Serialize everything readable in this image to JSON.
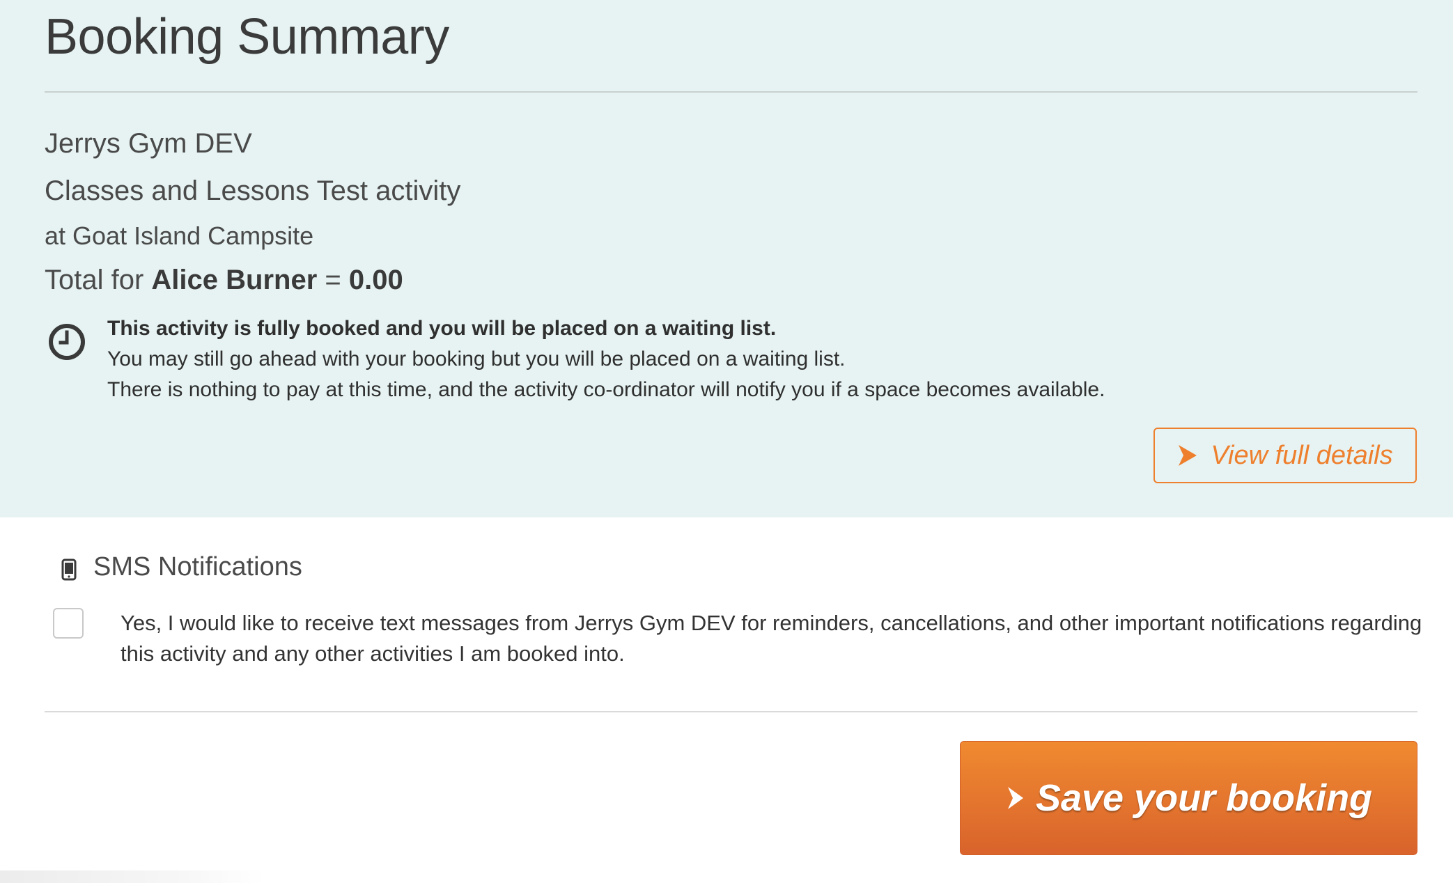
{
  "summary": {
    "title": "Booking Summary",
    "venue": "Jerrys Gym DEV",
    "activity": "Classes and Lessons Test activity",
    "location": "at Goat Island Campsite",
    "total_prefix": "Total for",
    "participant": "Alice Burner",
    "equals": "=",
    "amount": "0.00"
  },
  "waitlist": {
    "icon": "clock-icon",
    "heading": "This activity is fully booked and you will be placed on a waiting list.",
    "line1": "You may still go ahead with your booking but you will be placed on a waiting list.",
    "line2": "There is nothing to pay at this time, and the activity co-ordinator will notify you if a space becomes available."
  },
  "details_button": {
    "label": "View full details",
    "icon": "chevron-right-icon"
  },
  "sms": {
    "icon": "mobile-phone-icon",
    "heading": "SMS Notifications",
    "consent_text": "Yes, I would like to receive text messages from Jerrys Gym DEV for reminders, cancellations, and other important notifications regarding this activity and any other activities I am booked into.",
    "checked": false
  },
  "save_button": {
    "label": "Save your booking",
    "icon": "chevron-right-icon"
  },
  "colors": {
    "accent": "#ee7f2d",
    "panel_bg": "#e6f3f2"
  }
}
